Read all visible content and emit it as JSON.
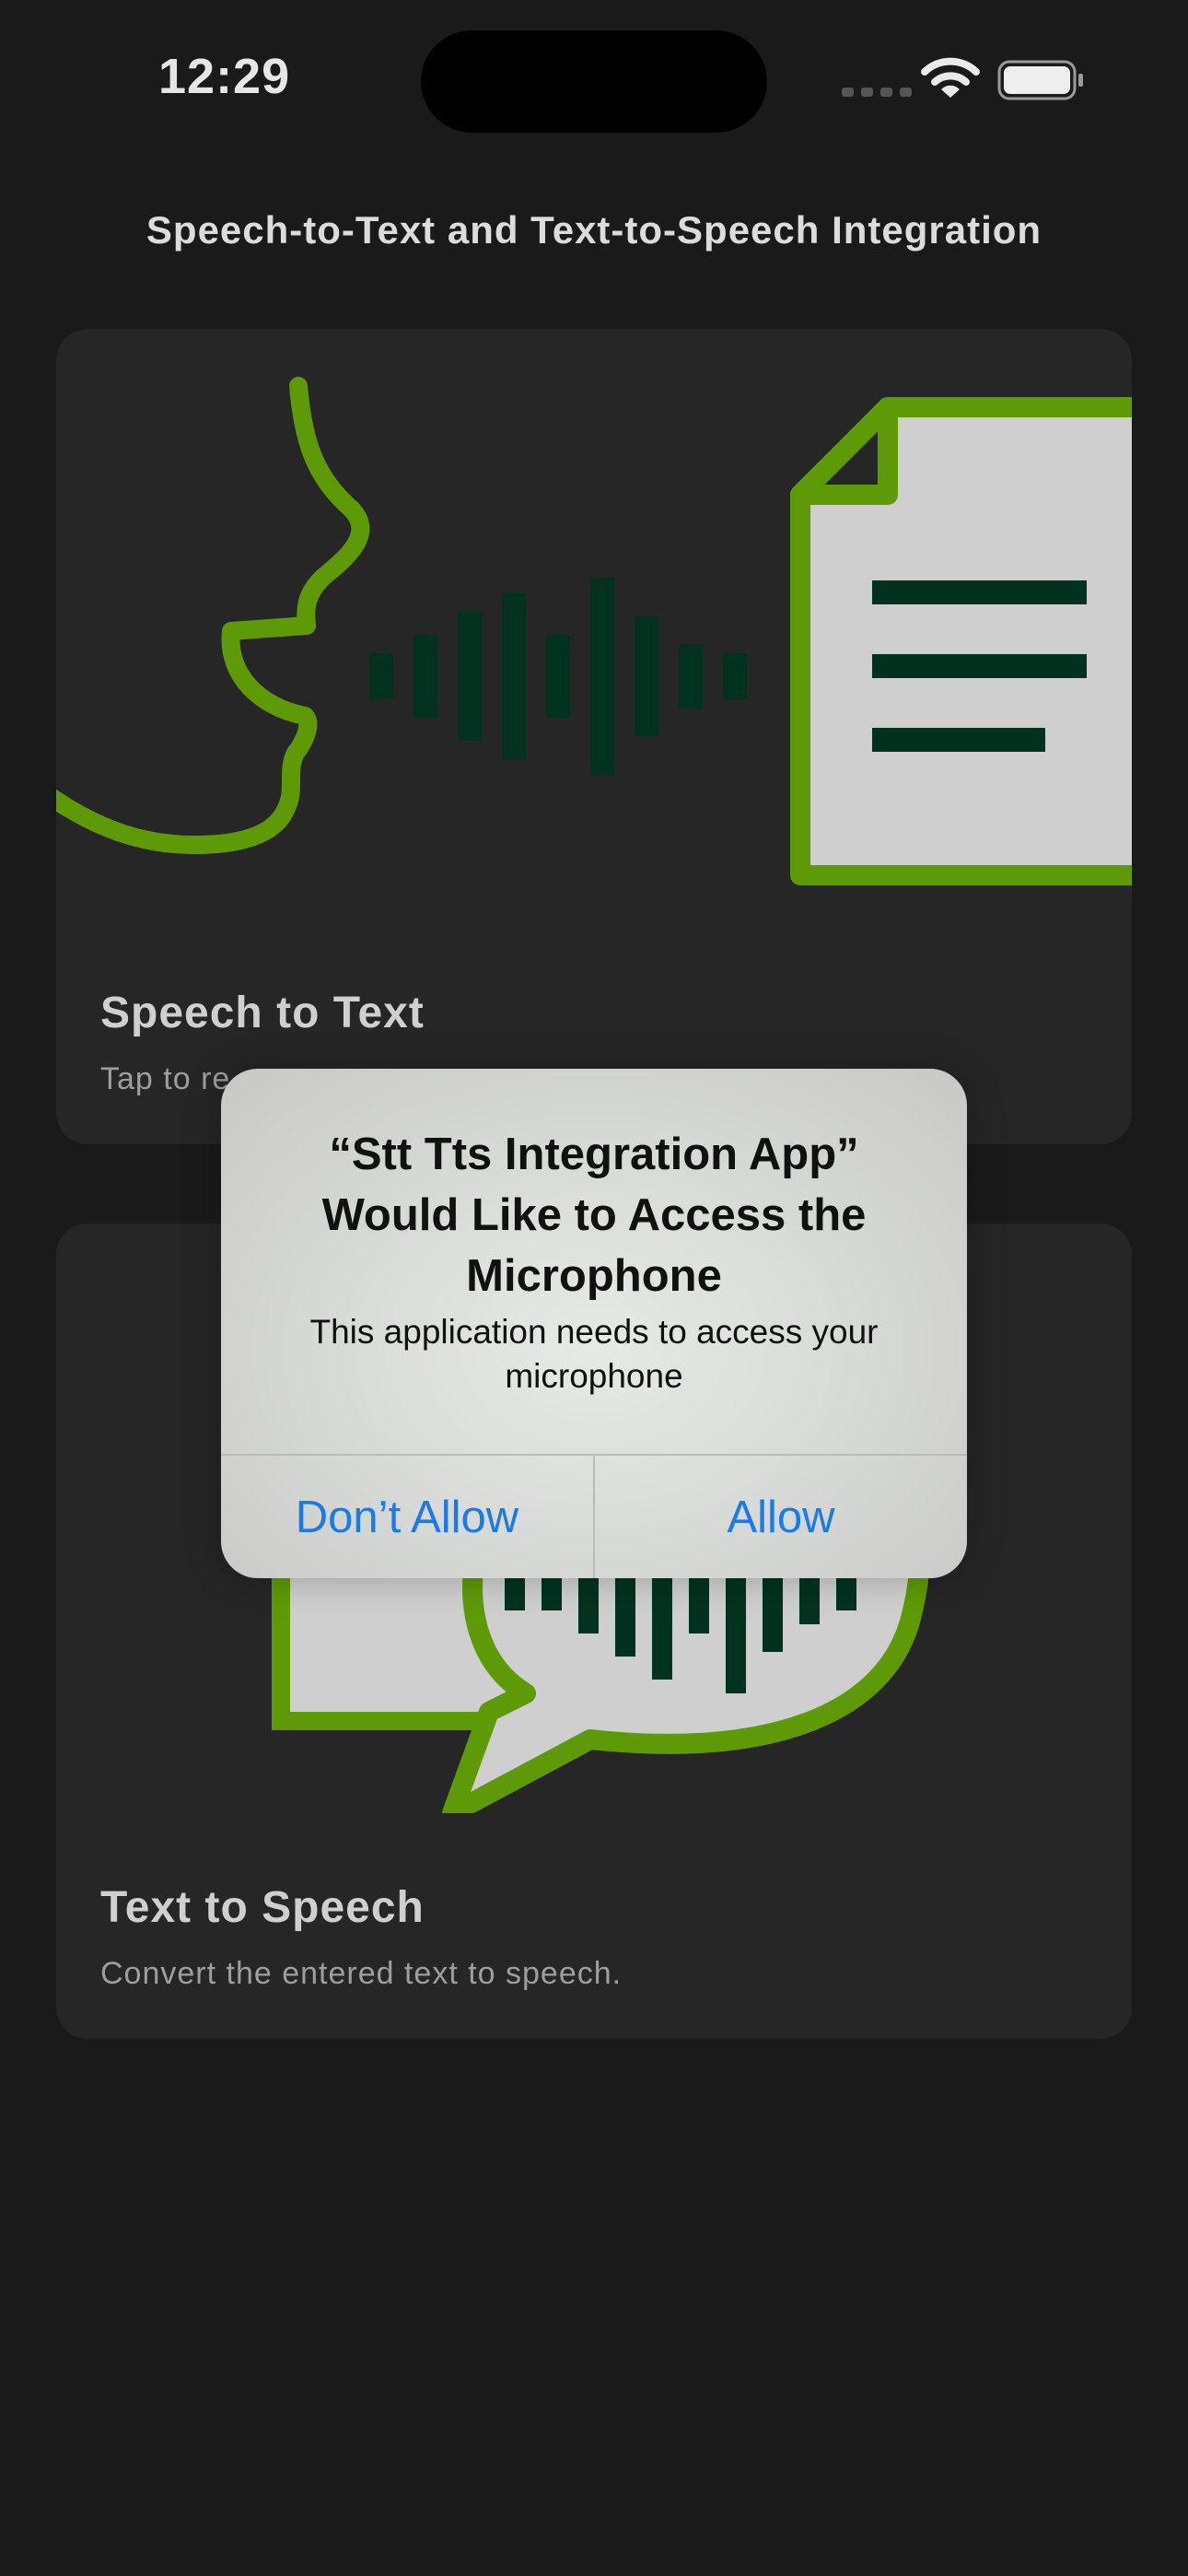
{
  "status_bar": {
    "time": "12:29",
    "icons": [
      "signal-icon",
      "wifi-icon",
      "battery-icon"
    ]
  },
  "header": {
    "title": "Speech-to-Text and Text-to-Speech Integration"
  },
  "cards": [
    {
      "title": "Speech to Text",
      "subtitle": "Tap to re",
      "illustration": "speaking-face-to-document-icon"
    },
    {
      "title": "Text to Speech",
      "subtitle": "Convert the entered text to speech.",
      "illustration": "document-to-speech-bubble-icon"
    }
  ],
  "alert": {
    "title": "“Stt Tts Integration App” Would Like to Access the Microphone",
    "message": "This application needs to access your microphone",
    "deny_label": "Don’t Allow",
    "allow_label": "Allow"
  },
  "colors": {
    "background": "#1a1a1a",
    "card": "#262626",
    "accent_green": "#5e9a07",
    "wave_dark_green": "#00331f",
    "document_fill": "#cfcfcf",
    "alert_button_blue": "#1a7ae8"
  }
}
